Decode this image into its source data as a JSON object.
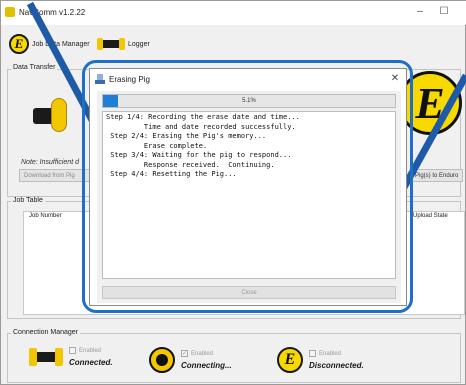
{
  "window": {
    "title": "NavComm v1.2.22",
    "min_glyph": "–",
    "max_glyph": "☐"
  },
  "tabs": [
    {
      "label": "Job Data Manager"
    },
    {
      "label": "Logger"
    }
  ],
  "data_transfer": {
    "group_label": "Data Transfer",
    "note": "Note: Insufficient d",
    "download_label": "Download from Pig",
    "upload_label": "Pig(s) to Enduro"
  },
  "job_table": {
    "group_label": "Job Table",
    "col_job_number": "Job Number",
    "col_upload_state": "Upload State"
  },
  "connection": {
    "group_label": "Connection Manager",
    "items": [
      {
        "checkbox_label": "Enabled",
        "status": "Connected.",
        "checked": false
      },
      {
        "checkbox_label": "Enabled",
        "status": "Connecting...",
        "checked": true
      },
      {
        "checkbox_label": "Enabled",
        "status": "Disconnected.",
        "checked": false
      }
    ]
  },
  "dialog": {
    "title": "Erasing Pig",
    "close_glyph": "✕",
    "progress_percent": 5.1,
    "progress_text": "5.1%",
    "log": "Step 1/4: Recording the erase date and time...\n         Time and date recorded successfully.\n Step 2/4: Erasing the Pig's memory...\n         Erase complete.\n Step 3/4: Waiting for the pig to respond...\n         Response received.  Continuing.\n Step 4/4: Resetting the Pig...",
    "close_button": "Close"
  },
  "badge_letter": "E",
  "colors": {
    "accent_blue": "#1f6fc8",
    "progress_fill": "#1e7fd6",
    "brand_yellow": "#f7d900"
  }
}
